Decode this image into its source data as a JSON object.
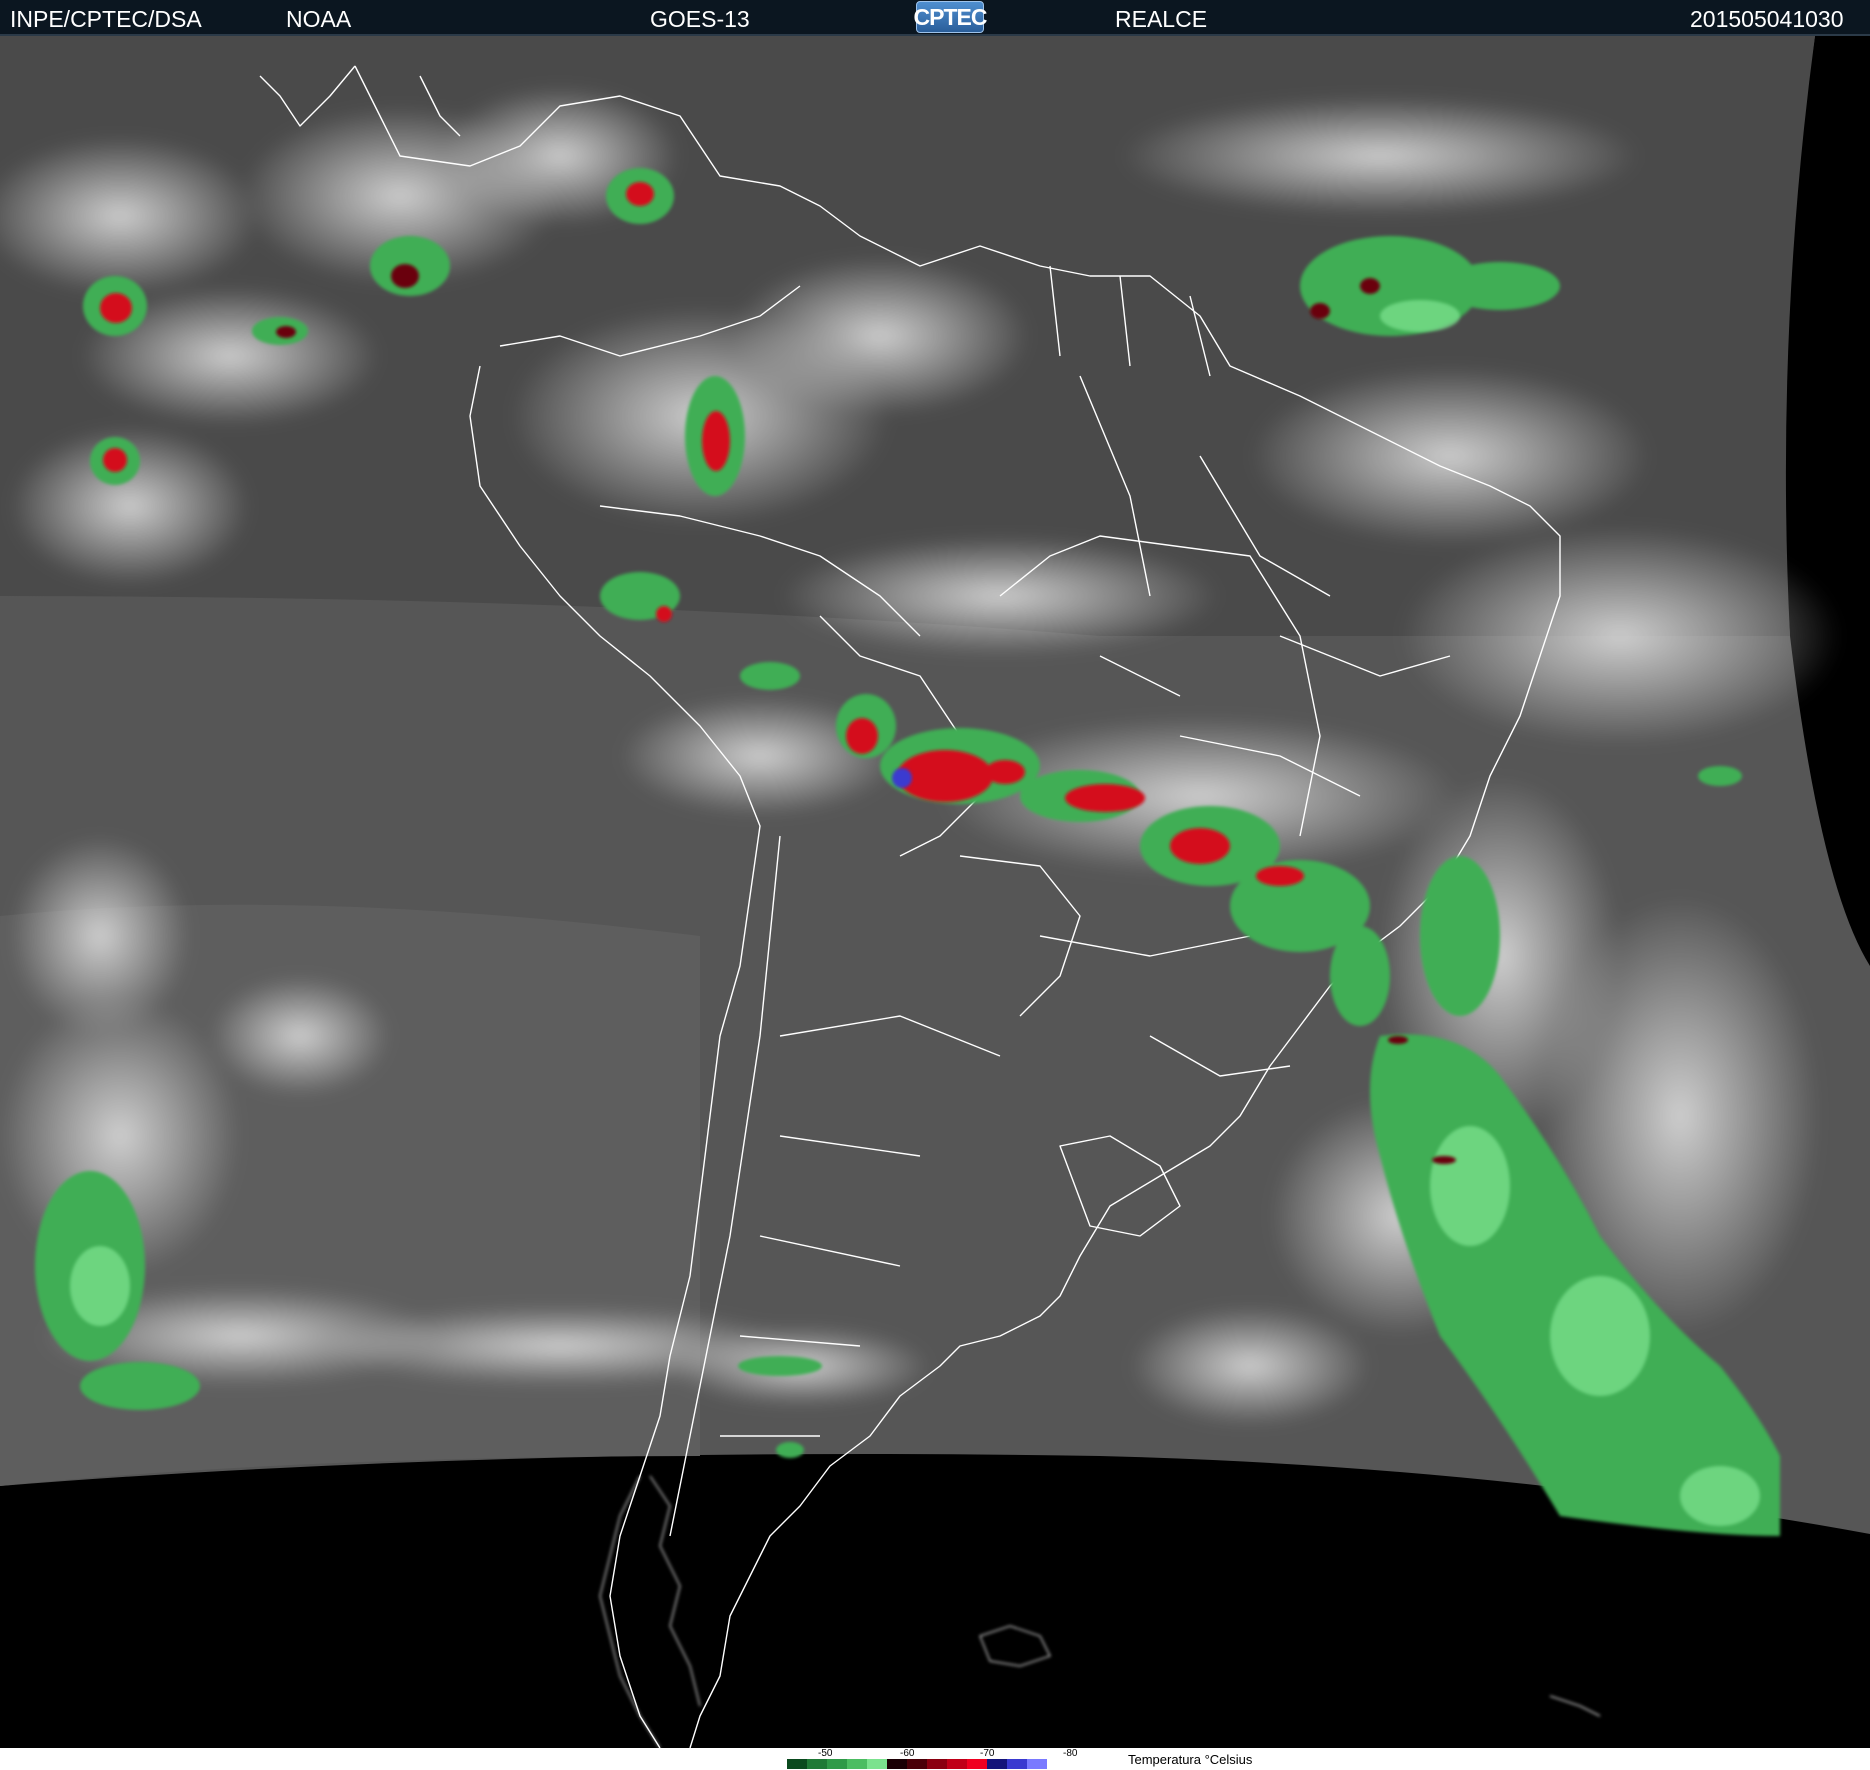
{
  "header": {
    "source": "INPE/CPTEC/DSA",
    "agency": "NOAA",
    "satellite": "GOES-13",
    "logo_text": "CPTEC",
    "product": "REALCE",
    "timestamp": "201505041030"
  },
  "legend": {
    "title": "Temperatura °Celsius",
    "ticks": [
      "-50",
      "-60",
      "-70",
      "-80"
    ],
    "colors": [
      "#0a4a1e",
      "#1f7a36",
      "#2f9a48",
      "#4cbd62",
      "#7be28e",
      "#1a0004",
      "#4a0008",
      "#8a0010",
      "#c00018",
      "#f00020",
      "#14147a",
      "#3a3ad0",
      "#7a7aff"
    ]
  },
  "map": {
    "colors": {
      "background_space": "#000000",
      "clear_sky": "#5a5a5a",
      "clouds": "#c8c8c8",
      "cold_green": "#3fae55",
      "very_cold_red": "#d4101a",
      "coldest_blue": "#3a3ad0",
      "borders": "#ffffff"
    }
  }
}
